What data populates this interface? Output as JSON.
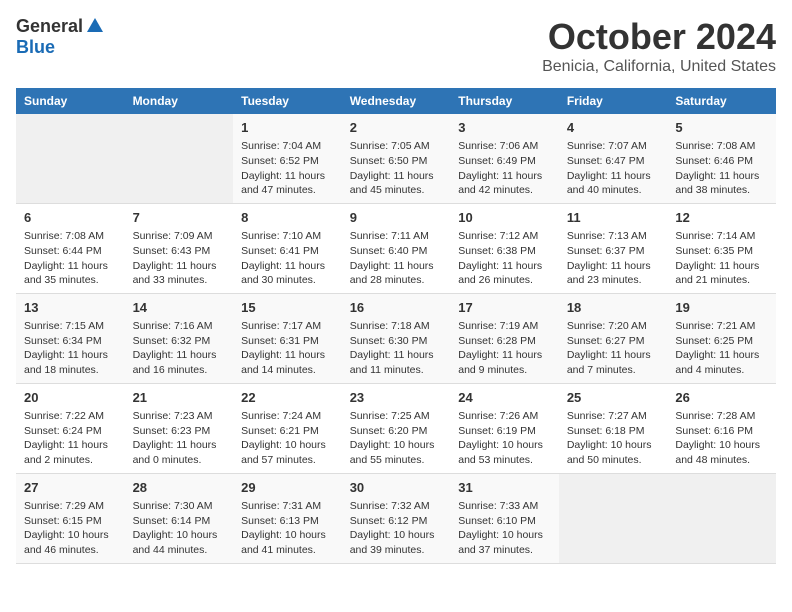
{
  "logo": {
    "general": "General",
    "blue": "Blue"
  },
  "title": "October 2024",
  "location": "Benicia, California, United States",
  "headers": [
    "Sunday",
    "Monday",
    "Tuesday",
    "Wednesday",
    "Thursday",
    "Friday",
    "Saturday"
  ],
  "weeks": [
    [
      {
        "day": "",
        "empty": true
      },
      {
        "day": "",
        "empty": true
      },
      {
        "day": "1",
        "sunrise": "Sunrise: 7:04 AM",
        "sunset": "Sunset: 6:52 PM",
        "daylight": "Daylight: 11 hours and 47 minutes."
      },
      {
        "day": "2",
        "sunrise": "Sunrise: 7:05 AM",
        "sunset": "Sunset: 6:50 PM",
        "daylight": "Daylight: 11 hours and 45 minutes."
      },
      {
        "day": "3",
        "sunrise": "Sunrise: 7:06 AM",
        "sunset": "Sunset: 6:49 PM",
        "daylight": "Daylight: 11 hours and 42 minutes."
      },
      {
        "day": "4",
        "sunrise": "Sunrise: 7:07 AM",
        "sunset": "Sunset: 6:47 PM",
        "daylight": "Daylight: 11 hours and 40 minutes."
      },
      {
        "day": "5",
        "sunrise": "Sunrise: 7:08 AM",
        "sunset": "Sunset: 6:46 PM",
        "daylight": "Daylight: 11 hours and 38 minutes."
      }
    ],
    [
      {
        "day": "6",
        "sunrise": "Sunrise: 7:08 AM",
        "sunset": "Sunset: 6:44 PM",
        "daylight": "Daylight: 11 hours and 35 minutes."
      },
      {
        "day": "7",
        "sunrise": "Sunrise: 7:09 AM",
        "sunset": "Sunset: 6:43 PM",
        "daylight": "Daylight: 11 hours and 33 minutes."
      },
      {
        "day": "8",
        "sunrise": "Sunrise: 7:10 AM",
        "sunset": "Sunset: 6:41 PM",
        "daylight": "Daylight: 11 hours and 30 minutes."
      },
      {
        "day": "9",
        "sunrise": "Sunrise: 7:11 AM",
        "sunset": "Sunset: 6:40 PM",
        "daylight": "Daylight: 11 hours and 28 minutes."
      },
      {
        "day": "10",
        "sunrise": "Sunrise: 7:12 AM",
        "sunset": "Sunset: 6:38 PM",
        "daylight": "Daylight: 11 hours and 26 minutes."
      },
      {
        "day": "11",
        "sunrise": "Sunrise: 7:13 AM",
        "sunset": "Sunset: 6:37 PM",
        "daylight": "Daylight: 11 hours and 23 minutes."
      },
      {
        "day": "12",
        "sunrise": "Sunrise: 7:14 AM",
        "sunset": "Sunset: 6:35 PM",
        "daylight": "Daylight: 11 hours and 21 minutes."
      }
    ],
    [
      {
        "day": "13",
        "sunrise": "Sunrise: 7:15 AM",
        "sunset": "Sunset: 6:34 PM",
        "daylight": "Daylight: 11 hours and 18 minutes."
      },
      {
        "day": "14",
        "sunrise": "Sunrise: 7:16 AM",
        "sunset": "Sunset: 6:32 PM",
        "daylight": "Daylight: 11 hours and 16 minutes."
      },
      {
        "day": "15",
        "sunrise": "Sunrise: 7:17 AM",
        "sunset": "Sunset: 6:31 PM",
        "daylight": "Daylight: 11 hours and 14 minutes."
      },
      {
        "day": "16",
        "sunrise": "Sunrise: 7:18 AM",
        "sunset": "Sunset: 6:30 PM",
        "daylight": "Daylight: 11 hours and 11 minutes."
      },
      {
        "day": "17",
        "sunrise": "Sunrise: 7:19 AM",
        "sunset": "Sunset: 6:28 PM",
        "daylight": "Daylight: 11 hours and 9 minutes."
      },
      {
        "day": "18",
        "sunrise": "Sunrise: 7:20 AM",
        "sunset": "Sunset: 6:27 PM",
        "daylight": "Daylight: 11 hours and 7 minutes."
      },
      {
        "day": "19",
        "sunrise": "Sunrise: 7:21 AM",
        "sunset": "Sunset: 6:25 PM",
        "daylight": "Daylight: 11 hours and 4 minutes."
      }
    ],
    [
      {
        "day": "20",
        "sunrise": "Sunrise: 7:22 AM",
        "sunset": "Sunset: 6:24 PM",
        "daylight": "Daylight: 11 hours and 2 minutes."
      },
      {
        "day": "21",
        "sunrise": "Sunrise: 7:23 AM",
        "sunset": "Sunset: 6:23 PM",
        "daylight": "Daylight: 11 hours and 0 minutes."
      },
      {
        "day": "22",
        "sunrise": "Sunrise: 7:24 AM",
        "sunset": "Sunset: 6:21 PM",
        "daylight": "Daylight: 10 hours and 57 minutes."
      },
      {
        "day": "23",
        "sunrise": "Sunrise: 7:25 AM",
        "sunset": "Sunset: 6:20 PM",
        "daylight": "Daylight: 10 hours and 55 minutes."
      },
      {
        "day": "24",
        "sunrise": "Sunrise: 7:26 AM",
        "sunset": "Sunset: 6:19 PM",
        "daylight": "Daylight: 10 hours and 53 minutes."
      },
      {
        "day": "25",
        "sunrise": "Sunrise: 7:27 AM",
        "sunset": "Sunset: 6:18 PM",
        "daylight": "Daylight: 10 hours and 50 minutes."
      },
      {
        "day": "26",
        "sunrise": "Sunrise: 7:28 AM",
        "sunset": "Sunset: 6:16 PM",
        "daylight": "Daylight: 10 hours and 48 minutes."
      }
    ],
    [
      {
        "day": "27",
        "sunrise": "Sunrise: 7:29 AM",
        "sunset": "Sunset: 6:15 PM",
        "daylight": "Daylight: 10 hours and 46 minutes."
      },
      {
        "day": "28",
        "sunrise": "Sunrise: 7:30 AM",
        "sunset": "Sunset: 6:14 PM",
        "daylight": "Daylight: 10 hours and 44 minutes."
      },
      {
        "day": "29",
        "sunrise": "Sunrise: 7:31 AM",
        "sunset": "Sunset: 6:13 PM",
        "daylight": "Daylight: 10 hours and 41 minutes."
      },
      {
        "day": "30",
        "sunrise": "Sunrise: 7:32 AM",
        "sunset": "Sunset: 6:12 PM",
        "daylight": "Daylight: 10 hours and 39 minutes."
      },
      {
        "day": "31",
        "sunrise": "Sunrise: 7:33 AM",
        "sunset": "Sunset: 6:10 PM",
        "daylight": "Daylight: 10 hours and 37 minutes."
      },
      {
        "day": "",
        "empty": true
      },
      {
        "day": "",
        "empty": true
      }
    ]
  ]
}
